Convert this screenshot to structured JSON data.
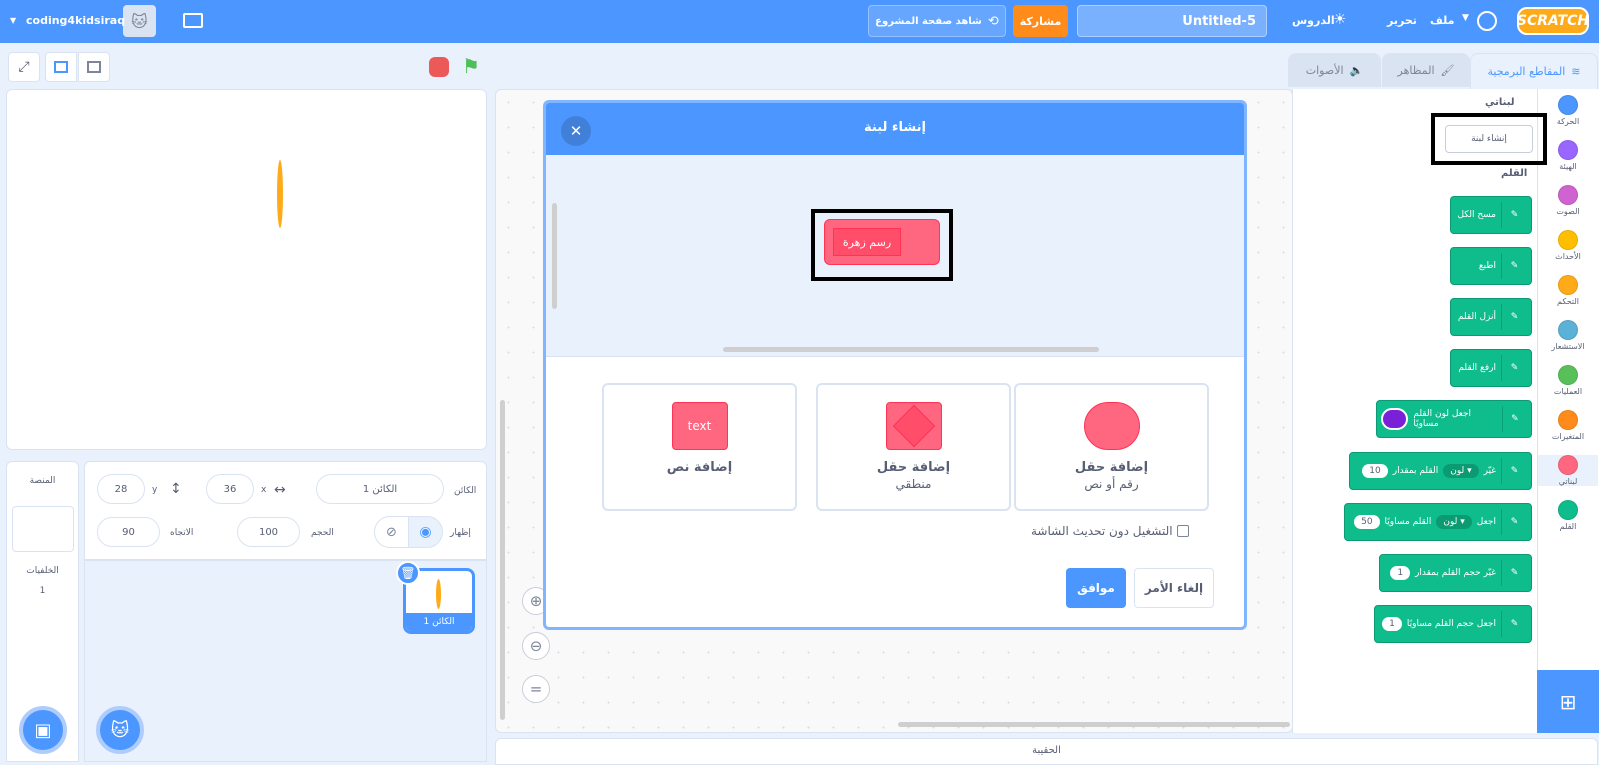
{
  "topbar": {
    "logo": "SCRATCH",
    "menu_file": "ملف",
    "menu_edit": "تحرير",
    "tutorials": "الدروس",
    "project_title": "Untitled-5",
    "share": "مشاركة",
    "see_project_page": "شاهد صفحة المشروع",
    "username": "coding4kidsiraq"
  },
  "tabs": {
    "code": "المقاطع البرمجية",
    "costumes": "المظاهر",
    "sounds": "الأصوات"
  },
  "categories": [
    {
      "label": "الحركة",
      "color": "#4c97ff"
    },
    {
      "label": "الهيئة",
      "color": "#9966ff"
    },
    {
      "label": "الصوت",
      "color": "#cf63cf"
    },
    {
      "label": "الأحداث",
      "color": "#ffbf00"
    },
    {
      "label": "التحكم",
      "color": "#ffab19"
    },
    {
      "label": "الاستشعار",
      "color": "#5cb1d6"
    },
    {
      "label": "العمليات",
      "color": "#59c059"
    },
    {
      "label": "المتغيرات",
      "color": "#ff8c1a"
    },
    {
      "label": "لبناتي",
      "color": "#ff6680"
    },
    {
      "label": "القلم",
      "color": "#0fbd8c"
    }
  ],
  "palette": {
    "my_blocks_heading": "لبناتي",
    "make_block_button": "إنشاء لبنة",
    "pen_heading": "القلم",
    "blocks": {
      "erase_all": "مسح الكل",
      "stamp": "اطبع",
      "pen_down": "أنزل القلم",
      "pen_up": "ارفع القلم",
      "set_pen_color_to": "اجعل لون القلم مساويًا",
      "change_pen": "غيّر",
      "by": "القلم بمقدار",
      "color_dropdown": "لون",
      "change_value": "10",
      "set_pen": "اجعل",
      "equal": "القلم مساويًا",
      "set_value": "50",
      "change_size_by": "غيّر حجم القلم بمقدار",
      "change_size_value": "1",
      "set_size_to": "اجعل حجم القلم مساويًا",
      "set_size_value": "1"
    }
  },
  "dialog": {
    "title": "إنشاء لبنة",
    "block_name": "رسم زهرة",
    "add_input_title": "إضافة حقل",
    "add_input_subtitle": "رقم أو نص",
    "add_boolean_title": "إضافة حقل",
    "add_boolean_subtitle": "منطقي",
    "add_label_title": "إضافة نص",
    "text_shape": "text",
    "run_without_refresh": "التشغيل دون تحديث الشاشة",
    "cancel": "إلغاء الأمر",
    "ok": "موافق"
  },
  "sprite_info": {
    "sprite_label": "الكائن",
    "sprite_name": "الكائن 1",
    "x_label": "x",
    "x_value": "36",
    "y_label": "y",
    "y_value": "28",
    "show_label": "إظهار",
    "size_label": "الحجم",
    "size_value": "100",
    "direction_label": "الاتجاه",
    "direction_value": "90"
  },
  "sprite_list": {
    "sprite_name": "الكائن 1"
  },
  "stage_panel": {
    "title": "المنصة",
    "backdrops_label": "الخلفيات",
    "backdrops_count": "1"
  },
  "backpack": "الحقيبة"
}
